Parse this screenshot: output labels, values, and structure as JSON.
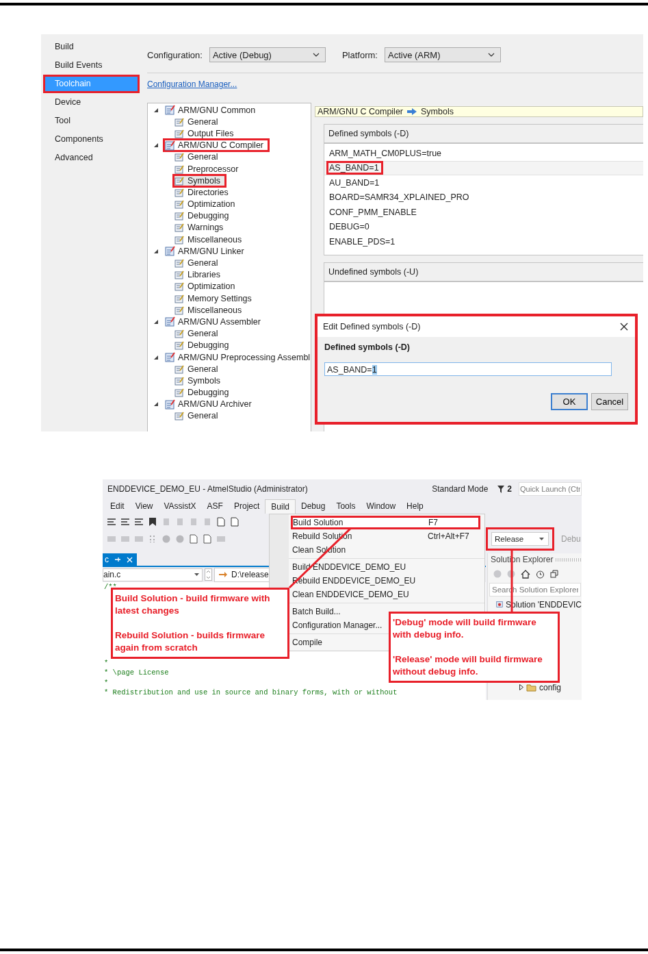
{
  "screenshot_1": {
    "sidebar": [
      {
        "label": "Build",
        "selected": false,
        "marked": false
      },
      {
        "label": "Build Events",
        "selected": false,
        "marked": false
      },
      {
        "label": "Toolchain",
        "selected": true,
        "marked": true
      },
      {
        "label": "Device",
        "selected": false,
        "marked": false
      },
      {
        "label": "Tool",
        "selected": false,
        "marked": false
      },
      {
        "label": "Components",
        "selected": false,
        "marked": false
      },
      {
        "label": "Advanced",
        "selected": false,
        "marked": false
      }
    ],
    "configuration": {
      "label": "Configuration:",
      "value": "Active (Debug)"
    },
    "platform": {
      "label": "Platform:",
      "value": "Active (ARM)"
    },
    "config_manager_link": "Configuration Manager...",
    "tree": [
      {
        "label": "ARM/GNU Common",
        "expanded": true,
        "marked": false,
        "children": [
          {
            "label": "General",
            "selected": false,
            "marked": false
          },
          {
            "label": "Output Files",
            "selected": false,
            "marked": false
          }
        ]
      },
      {
        "label": "ARM/GNU C Compiler",
        "expanded": true,
        "marked": true,
        "children": [
          {
            "label": "General",
            "selected": false,
            "marked": false
          },
          {
            "label": "Preprocessor",
            "selected": false,
            "marked": false
          },
          {
            "label": "Symbols",
            "selected": true,
            "marked": true
          },
          {
            "label": "Directories",
            "selected": false,
            "marked": false
          },
          {
            "label": "Optimization",
            "selected": false,
            "marked": false
          },
          {
            "label": "Debugging",
            "selected": false,
            "marked": false
          },
          {
            "label": "Warnings",
            "selected": false,
            "marked": false
          },
          {
            "label": "Miscellaneous",
            "selected": false,
            "marked": false
          }
        ]
      },
      {
        "label": "ARM/GNU Linker",
        "expanded": true,
        "marked": false,
        "children": [
          {
            "label": "General",
            "selected": false,
            "marked": false
          },
          {
            "label": "Libraries",
            "selected": false,
            "marked": false
          },
          {
            "label": "Optimization",
            "selected": false,
            "marked": false
          },
          {
            "label": "Memory Settings",
            "selected": false,
            "marked": false
          },
          {
            "label": "Miscellaneous",
            "selected": false,
            "marked": false
          }
        ]
      },
      {
        "label": "ARM/GNU Assembler",
        "expanded": true,
        "marked": false,
        "children": [
          {
            "label": "General",
            "selected": false,
            "marked": false
          },
          {
            "label": "Debugging",
            "selected": false,
            "marked": false
          }
        ]
      },
      {
        "label": "ARM/GNU Preprocessing Assembl",
        "expanded": true,
        "marked": false,
        "children": [
          {
            "label": "General",
            "selected": false,
            "marked": false
          },
          {
            "label": "Symbols",
            "selected": false,
            "marked": false
          },
          {
            "label": "Debugging",
            "selected": false,
            "marked": false
          }
        ]
      },
      {
        "label": "ARM/GNU Archiver",
        "expanded": true,
        "marked": false,
        "children": [
          {
            "label": "General",
            "selected": false,
            "marked": false
          }
        ]
      }
    ],
    "breadcrumb": {
      "parent": "ARM/GNU C Compiler",
      "child": "Symbols"
    },
    "defined_symbols": {
      "title": "Defined symbols (-D)",
      "rows": [
        {
          "text": "ARM_MATH_CM0PLUS=true",
          "selected": false,
          "marked": false
        },
        {
          "text": "AS_BAND=1",
          "selected": true,
          "marked": true
        },
        {
          "text": "AU_BAND=1",
          "selected": false,
          "marked": false
        },
        {
          "text": "BOARD=SAMR34_XPLAINED_PRO",
          "selected": false,
          "marked": false
        },
        {
          "text": "CONF_PMM_ENABLE",
          "selected": false,
          "marked": false
        },
        {
          "text": "DEBUG=0",
          "selected": false,
          "marked": false
        },
        {
          "text": "ENABLE_PDS=1",
          "selected": false,
          "marked": false
        }
      ]
    },
    "undefined_symbols": {
      "title": "Undefined symbols (-U)"
    },
    "dialog": {
      "title": "Edit Defined symbols (-D)",
      "label": "Defined symbols (-D)",
      "value": "AS_BAND=",
      "value_selected": "1",
      "marked": true,
      "buttons": [
        {
          "label": "OK",
          "default": true
        },
        {
          "label": "Cancel",
          "default": false
        }
      ]
    }
  },
  "screenshot_2": {
    "title": "ENDDEVICE_DEMO_EU - AtmelStudio (Administrator)",
    "mode": "Standard Mode",
    "notification_count": "2",
    "quick_launch": {
      "placeholder": "Quick Launch (Ctr"
    },
    "menu": [
      {
        "label": "Edit",
        "selected": false
      },
      {
        "label": "View",
        "selected": false
      },
      {
        "label": "VAssistX",
        "selected": false
      },
      {
        "label": "ASF",
        "selected": false
      },
      {
        "label": "Project",
        "selected": false
      },
      {
        "label": "Build",
        "selected": true
      },
      {
        "label": "Debug",
        "selected": false
      },
      {
        "label": "Tools",
        "selected": false
      },
      {
        "label": "Window",
        "selected": false
      },
      {
        "label": "Help",
        "selected": false
      }
    ],
    "build_menu": [
      {
        "kind": "icon-item",
        "label": "Build Solution",
        "shortcut": "F7",
        "marked": true
      },
      {
        "kind": "item",
        "label": "Rebuild Solution",
        "shortcut": "Ctrl+Alt+F7",
        "marked": false
      },
      {
        "kind": "item",
        "label": "Clean Solution",
        "marked": false
      },
      {
        "kind": "separator"
      },
      {
        "kind": "icon-item",
        "label": "Build ENDDEVICE_DEMO_EU",
        "marked": false
      },
      {
        "kind": "item",
        "label": "Rebuild ENDDEVICE_DEMO_EU",
        "marked": false
      },
      {
        "kind": "item",
        "label": "Clean ENDDEVICE_DEMO_EU",
        "marked": false
      },
      {
        "kind": "separator"
      },
      {
        "kind": "item",
        "label": "Batch Build...",
        "marked": false
      },
      {
        "kind": "item",
        "label": "Configuration Manager...",
        "marked": false
      },
      {
        "kind": "separator"
      },
      {
        "kind": "item",
        "label": "Compile",
        "marked": false
      }
    ],
    "configuration_combo": {
      "value": "Release",
      "marked": true
    },
    "platform_combo_text": "Debu",
    "doc_tab": {
      "label": "c"
    },
    "navigation": {
      "scope": "ain.c",
      "path": "D:\\release"
    },
    "code_top": [
      "/**"
    ],
    "code_bottom": [
      "*",
      "* \\page License",
      "*",
      "* Redistribution and use in source and binary forms, with or without"
    ],
    "solution_explorer": {
      "title": "Solution Explorer",
      "search": {
        "placeholder": "Search Solution Explorer"
      },
      "tree_top": [
        {
          "kind": "solution",
          "label": "Solution 'ENDDEVIC"
        }
      ],
      "tree_bottom": [
        {
          "kind": "folder",
          "label": "config"
        }
      ]
    },
    "callouts": [
      {
        "paragraphs": [
          "Build Solution - build firmware with latest changes",
          "Rebuild Solution - builds firmware again from scratch"
        ]
      },
      {
        "paragraphs": [
          "'Debug' mode will build firmware with debug info.",
          "'Release' mode will build firmware without debug info."
        ]
      }
    ]
  }
}
